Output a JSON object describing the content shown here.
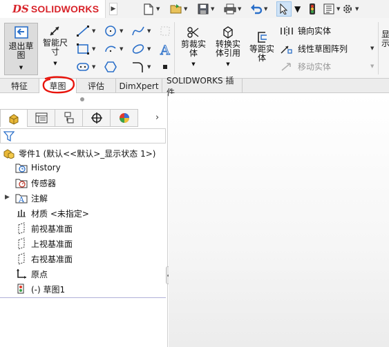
{
  "app": {
    "brand": "SOLIDWORKS",
    "logo_mark": "DS"
  },
  "quick_access": [
    {
      "icon": "new-document-icon"
    },
    {
      "icon": "open-folder-icon"
    },
    {
      "icon": "save-icon"
    },
    {
      "icon": "print-icon"
    },
    {
      "icon": "undo-icon"
    },
    {
      "icon": "select-pointer-icon"
    },
    {
      "icon": "traffic-light-icon"
    },
    {
      "icon": "file-properties-icon"
    },
    {
      "icon": "settings-gear-icon"
    }
  ],
  "ribbon": {
    "exit_sketch": "退出草图",
    "smart_dimension": "智能尺寸",
    "trim_entities": "剪裁实体",
    "convert_entities": "转换实体引用",
    "offset_entities": "等距实体",
    "mirror_entities": "镜向实体",
    "linear_pattern": "线性草图阵列",
    "move_entities": "移动实体",
    "overflow_label": "显\n示"
  },
  "tabs": [
    {
      "label": "特征",
      "active": false
    },
    {
      "label": "草图",
      "active": true
    },
    {
      "label": "评估",
      "active": false
    },
    {
      "label": "DimXpert",
      "active": false
    },
    {
      "label": "SOLIDWORKS 插件",
      "active": false
    }
  ],
  "feature_tree": {
    "root": "零件1  (默认<<默认>_显示状态 1>)",
    "items": [
      {
        "label": "History",
        "icon": "history-icon"
      },
      {
        "label": "传感器",
        "icon": "sensor-icon"
      },
      {
        "label": "注解",
        "icon": "annotation-icon"
      },
      {
        "label": "材质 <未指定>",
        "icon": "material-icon"
      },
      {
        "label": "前视基准面",
        "icon": "plane-icon"
      },
      {
        "label": "上视基准面",
        "icon": "plane-icon"
      },
      {
        "label": "右视基准面",
        "icon": "plane-icon"
      },
      {
        "label": "原点",
        "icon": "origin-icon"
      },
      {
        "label": "(-) 草图1",
        "icon": "sketch-icon"
      }
    ]
  },
  "colors": {
    "brand_red": "#d8232a",
    "annotation_red": "#e8140c",
    "active_tab": "#ffffff"
  }
}
